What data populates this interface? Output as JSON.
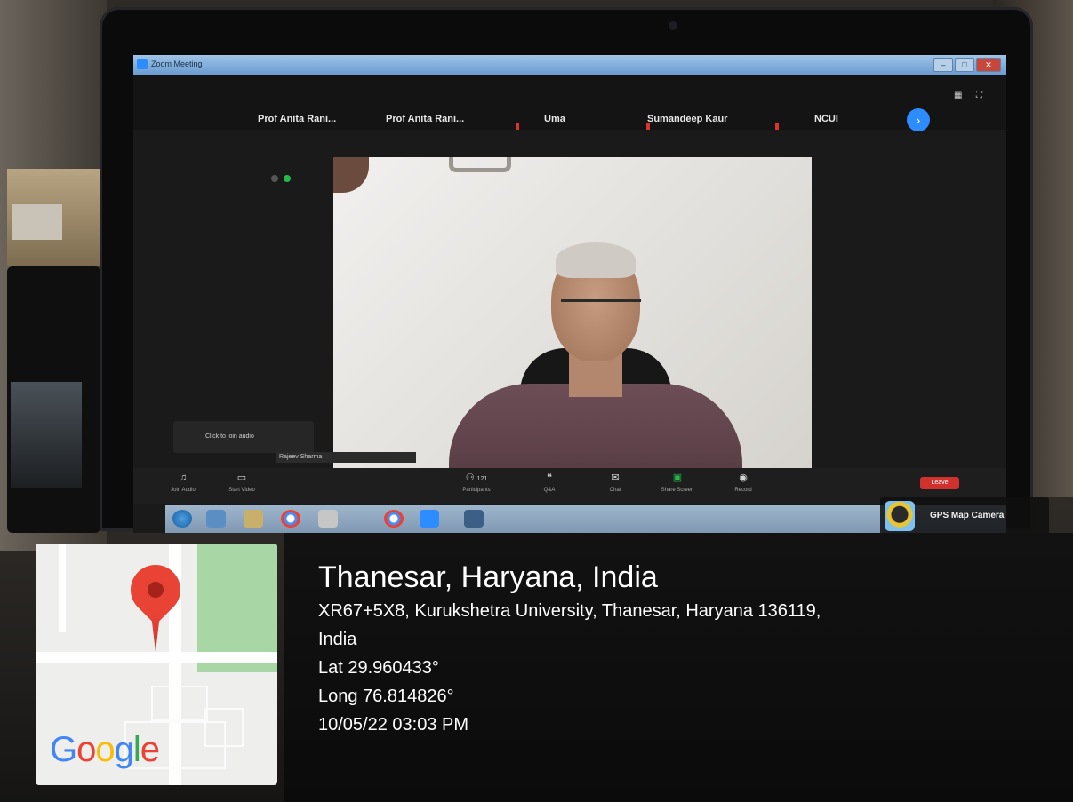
{
  "zoom_window": {
    "title": "Zoom Meeting",
    "participants_strip": [
      {
        "name": "Prof Anita Rani..."
      },
      {
        "name": "Prof Anita Rani..."
      },
      {
        "name": "Uma"
      },
      {
        "name": "Sumandeep Kaur"
      },
      {
        "name": "NCUI"
      }
    ],
    "audio_popup": "Click to join audio",
    "speaking_label": "Rajeev Sharma",
    "toolbar": {
      "join_audio": "Join Audio",
      "start_video": "Start Video",
      "participants": "Participants",
      "participants_count": "121",
      "qa": "Q&A",
      "chat": "Chat",
      "share_screen": "Share Screen",
      "record": "Record",
      "end": "Leave"
    }
  },
  "gps_badge": {
    "label": "GPS Map Camera",
    "icon": "camera-app-icon"
  },
  "map_card": {
    "logo_text": "Google",
    "pin_color": "#e84335"
  },
  "location": {
    "place": "Thanesar, Haryana, India",
    "address_line1": "XR67+5X8, Kurukshetra University, Thanesar, Haryana 136119,",
    "address_line2": "India",
    "latitude": "Lat 29.960433°",
    "longitude": "Long 76.814826°",
    "datetime": "10/05/22 03:03 PM"
  },
  "colors": {
    "accent": "#2d8cff",
    "end_button": "#d0312d",
    "share_green": "#25b94a"
  }
}
